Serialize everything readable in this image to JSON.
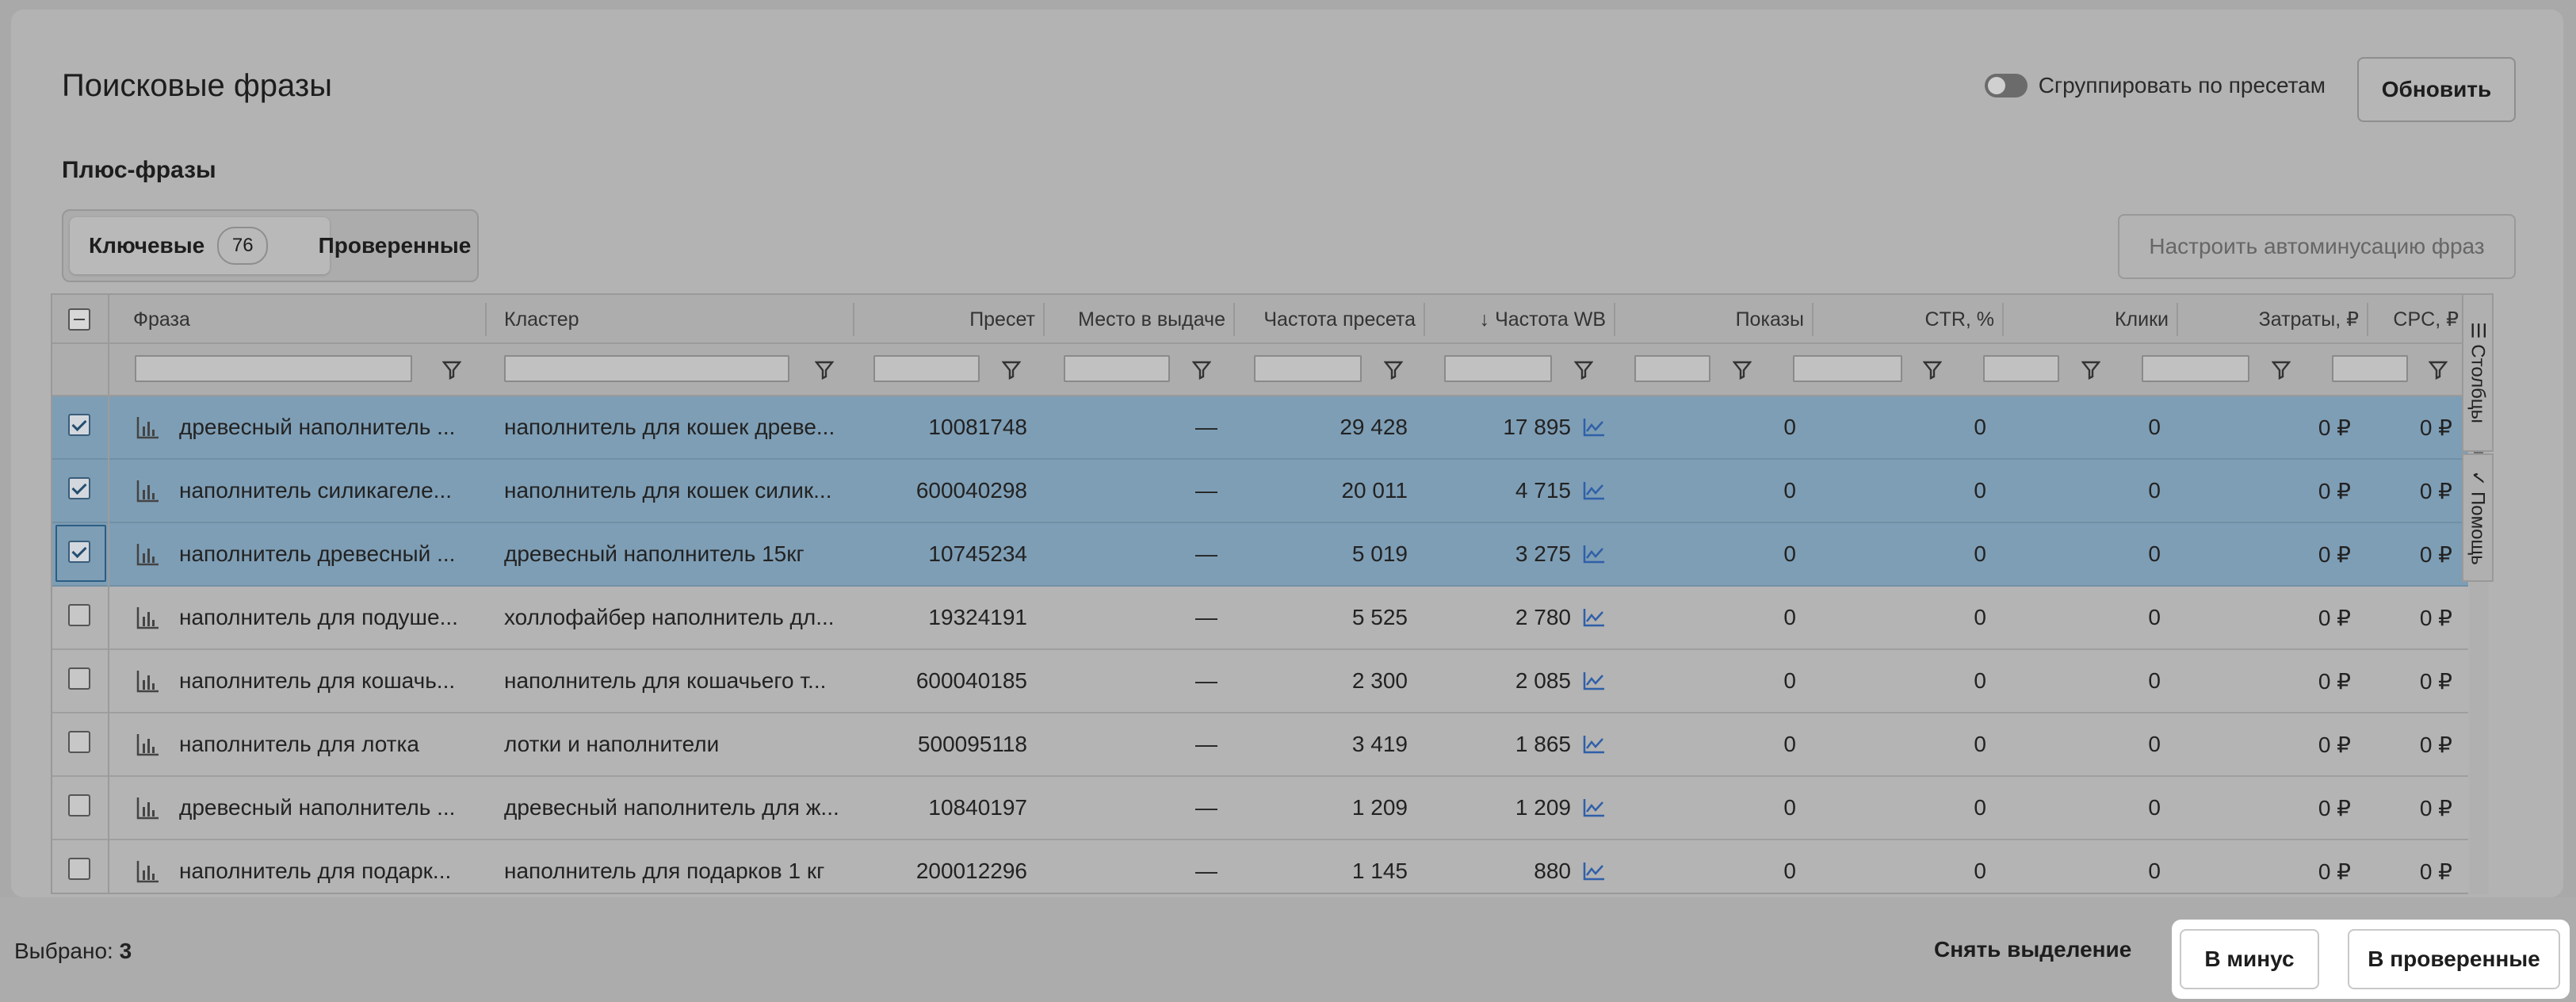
{
  "header": {
    "title": "Поисковые фразы",
    "group_toggle_label": "Сгруппировать по пресетам",
    "refresh_label": "Обновить"
  },
  "section": {
    "subtitle": "Плюс-фразы",
    "tabs": [
      {
        "label": "Ключевые",
        "count": "76"
      },
      {
        "label": "Проверенные"
      }
    ],
    "auto_minus_label": "Настроить автоминусацию фраз"
  },
  "table": {
    "columns": [
      "Фраза",
      "Кластер",
      "Пресет",
      "Место в выдаче",
      "Частота пресета",
      "↓ Частота WB",
      "Показы",
      "CTR, %",
      "Клики",
      "Затраты, ₽",
      "CPC, ₽"
    ],
    "rows": [
      {
        "phrase": "древесный наполнитель ...",
        "cluster": "наполнитель для кошек древе...",
        "preset": "10081748",
        "place": "—",
        "preset_freq": "29 428",
        "wb_freq": "17 895",
        "shows": "0",
        "ctr": "0",
        "clicks": "0",
        "cost": "0 ₽",
        "cpc": "0 ₽",
        "selected": true
      },
      {
        "phrase": "наполнитель силикагеле...",
        "cluster": "наполнитель для кошек силик...",
        "preset": "600040298",
        "place": "—",
        "preset_freq": "20 011",
        "wb_freq": "4 715",
        "shows": "0",
        "ctr": "0",
        "clicks": "0",
        "cost": "0 ₽",
        "cpc": "0 ₽",
        "selected": true
      },
      {
        "phrase": "наполнитель древесный ...",
        "cluster": "древесный наполнитель 15кг",
        "preset": "10745234",
        "place": "—",
        "preset_freq": "5 019",
        "wb_freq": "3 275",
        "shows": "0",
        "ctr": "0",
        "clicks": "0",
        "cost": "0 ₽",
        "cpc": "0 ₽",
        "selected": true
      },
      {
        "phrase": "наполнитель для подуше...",
        "cluster": "холлофайбер наполнитель дл...",
        "preset": "19324191",
        "place": "—",
        "preset_freq": "5 525",
        "wb_freq": "2 780",
        "shows": "0",
        "ctr": "0",
        "clicks": "0",
        "cost": "0 ₽",
        "cpc": "0 ₽",
        "selected": false
      },
      {
        "phrase": "наполнитель для кошачь...",
        "cluster": "наполнитель для кошачьего т...",
        "preset": "600040185",
        "place": "—",
        "preset_freq": "2 300",
        "wb_freq": "2 085",
        "shows": "0",
        "ctr": "0",
        "clicks": "0",
        "cost": "0 ₽",
        "cpc": "0 ₽",
        "selected": false
      },
      {
        "phrase": "наполнитель для лотка",
        "cluster": "лотки и наполнители",
        "preset": "500095118",
        "place": "—",
        "preset_freq": "3 419",
        "wb_freq": "1 865",
        "shows": "0",
        "ctr": "0",
        "clicks": "0",
        "cost": "0 ₽",
        "cpc": "0 ₽",
        "selected": false
      },
      {
        "phrase": "древесный наполнитель ...",
        "cluster": "древесный наполнитель для ж...",
        "preset": "10840197",
        "place": "—",
        "preset_freq": "1 209",
        "wb_freq": "1 209",
        "shows": "0",
        "ctr": "0",
        "clicks": "0",
        "cost": "0 ₽",
        "cpc": "0 ₽",
        "selected": false
      },
      {
        "phrase": "наполнитель для подарк...",
        "cluster": "наполнитель для подарков 1 кг",
        "preset": "200012296",
        "place": "—",
        "preset_freq": "1 145",
        "wb_freq": "880",
        "shows": "0",
        "ctr": "0",
        "clicks": "0",
        "cost": "0 ₽",
        "cpc": "0 ₽",
        "selected": false
      }
    ]
  },
  "side_panel": {
    "columns_label": "Столбцы",
    "help_label": "Помощь"
  },
  "footer": {
    "selected_label": "Выбрано:",
    "selected_count": "3",
    "clear_label": "Снять выделение",
    "to_minus_label": "В минус",
    "to_verified_label": "В проверенные"
  },
  "icons": [
    "bar-chart-icon",
    "filter-icon",
    "trend-chart-icon",
    "columns-icon",
    "help-icon"
  ]
}
